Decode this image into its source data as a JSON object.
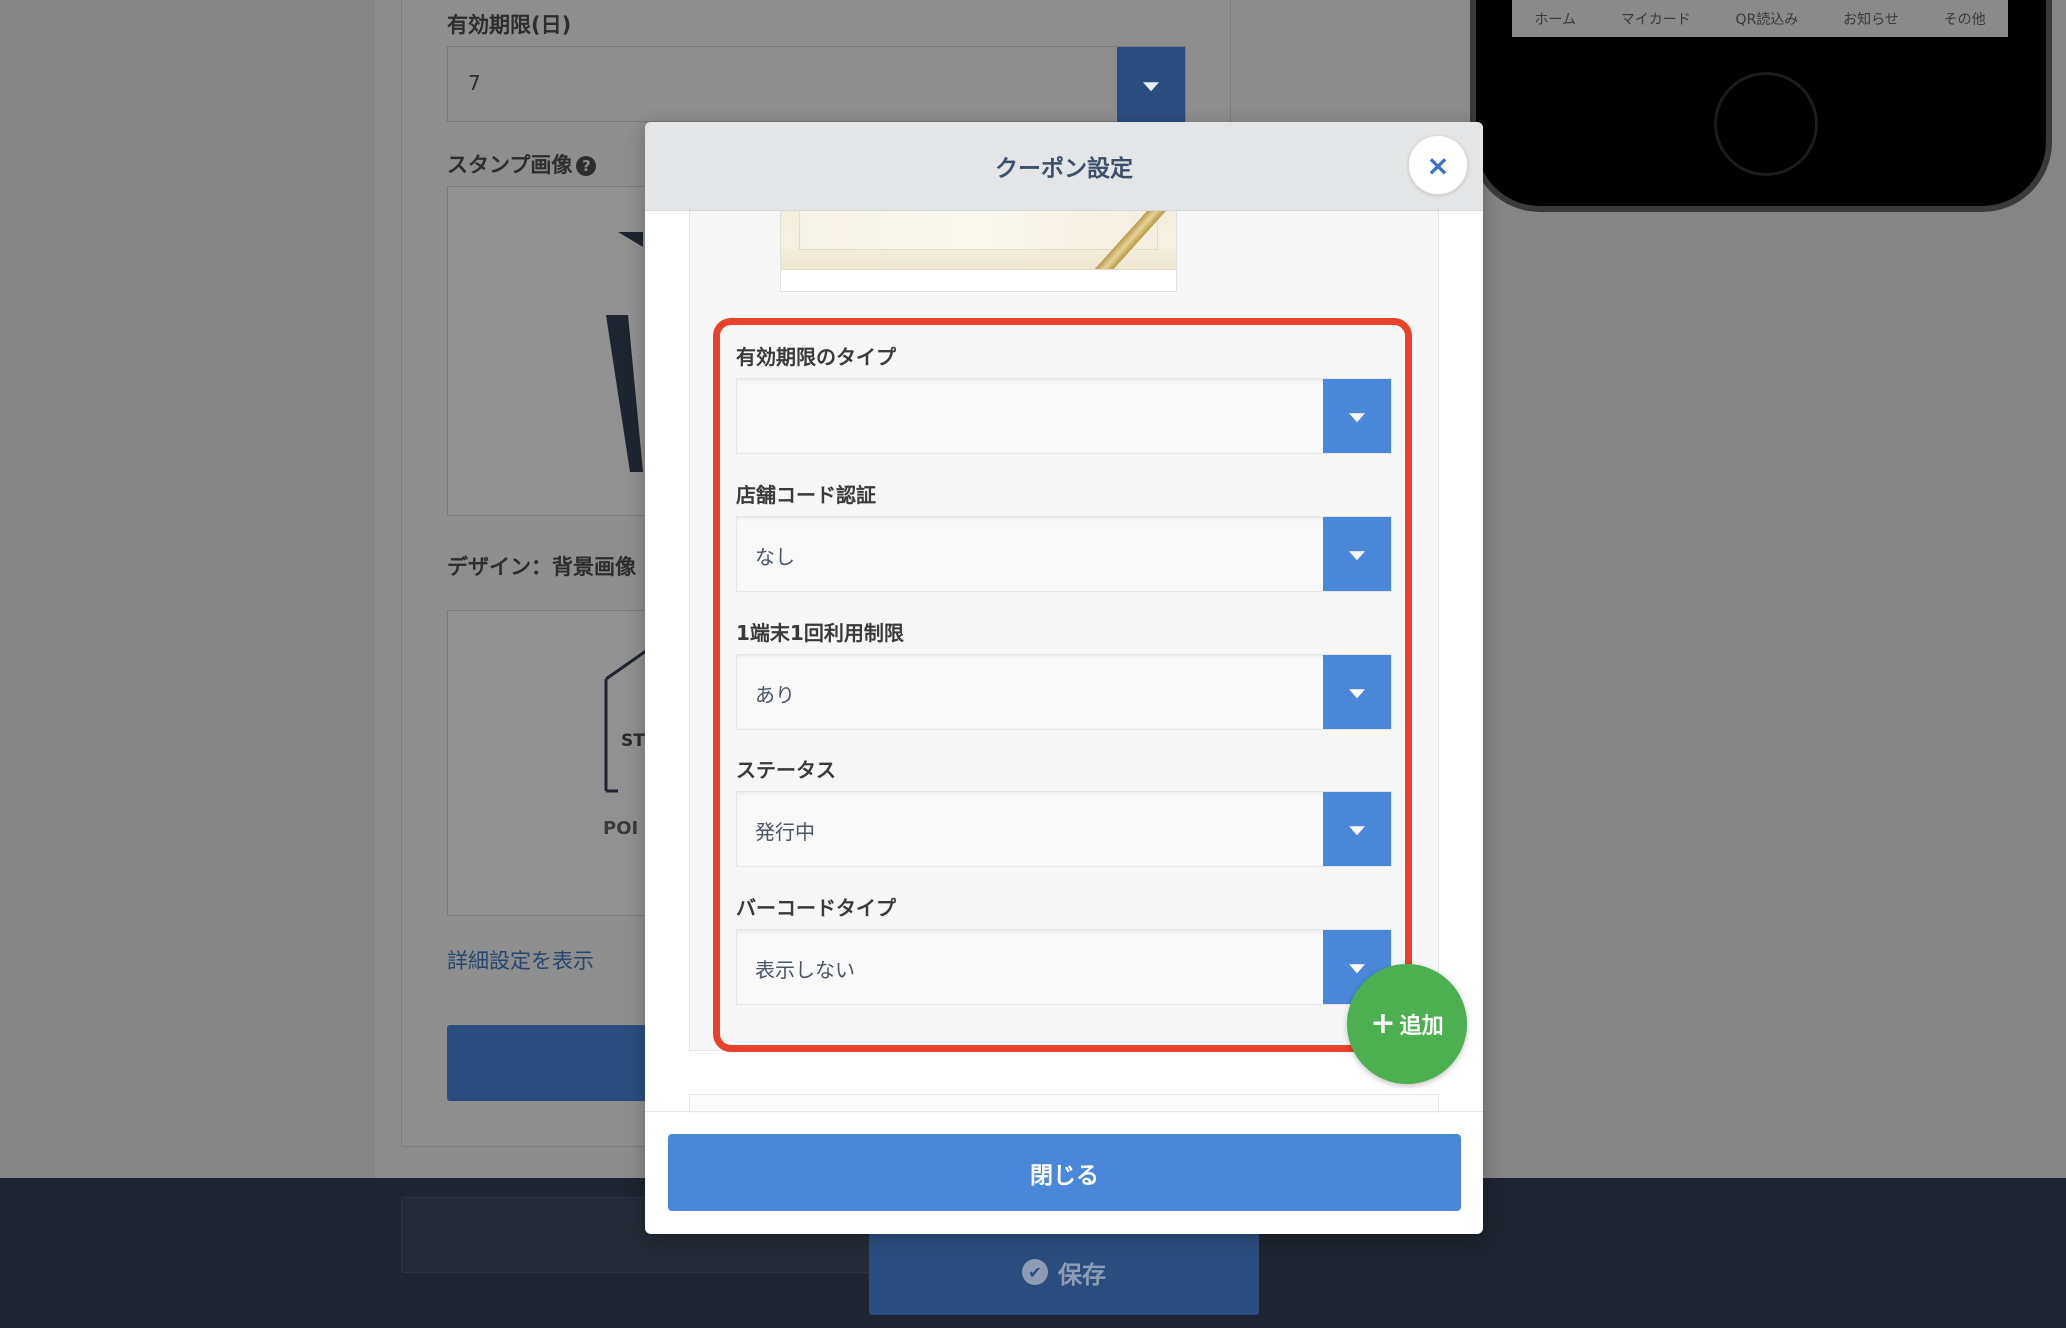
{
  "background": {
    "expiry_days_label": "有効期限(日)",
    "expiry_days_value": "7",
    "stamp_image_label": "スタンプ画像",
    "design_bg_label": "デザイン：背景画像",
    "design_preview_text_1": "ST",
    "design_preview_text_2": "POI",
    "detail_settings_link": "詳細設定を表示",
    "save_button": "保存",
    "phone_nav": [
      "ホーム",
      "マイカード",
      "QR読込み",
      "お知らせ",
      "その他"
    ]
  },
  "modal": {
    "title": "クーポン設定",
    "close_icon": "×",
    "fields": [
      {
        "label": "有効期限のタイプ",
        "value": ""
      },
      {
        "label": "店舗コード認証",
        "value": "なし"
      },
      {
        "label": "1端末1回利用制限",
        "value": "あり"
      },
      {
        "label": "ステータス",
        "value": "発行中"
      },
      {
        "label": "バーコードタイプ",
        "value": "表示しない"
      }
    ],
    "add_button_icon": "+",
    "add_button_label": "追加",
    "close_button": "閉じる"
  },
  "colors": {
    "accent": "#4a87d8",
    "highlight": "#e8422c",
    "add_button": "#4caf50"
  }
}
